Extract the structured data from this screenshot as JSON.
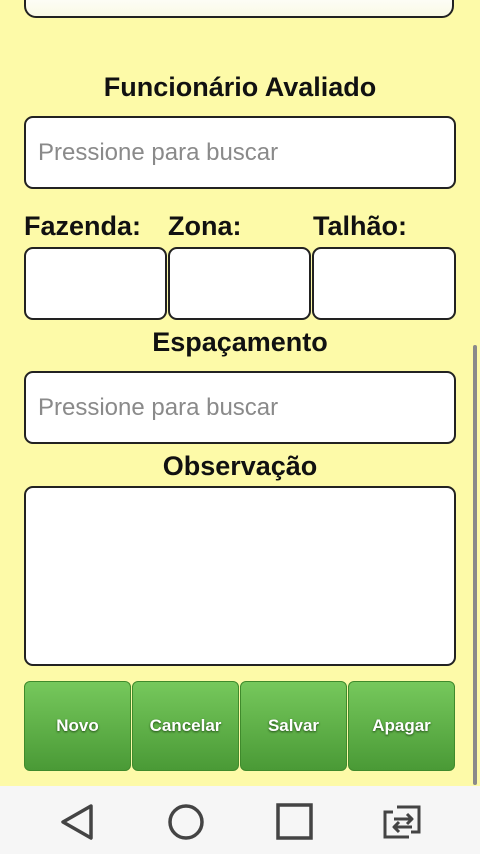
{
  "form": {
    "funcionario_label": "Funcionário Avaliado",
    "funcionario_placeholder": "Pressione para buscar",
    "fazenda_label": "Fazenda:",
    "zona_label": "Zona:",
    "talhao_label": "Talhão:",
    "espacamento_label": "Espaçamento",
    "espacamento_placeholder": "Pressione para buscar",
    "observacao_label": "Observação"
  },
  "actions": {
    "novo": "Novo",
    "cancelar": "Cancelar",
    "salvar": "Salvar",
    "apagar": "Apagar"
  },
  "navbar": {
    "icons": [
      "back-icon",
      "home-icon",
      "recents-icon",
      "switch-apps-icon"
    ]
  },
  "colors": {
    "background": "#fdfaa8",
    "button_green": "#5aad43"
  }
}
